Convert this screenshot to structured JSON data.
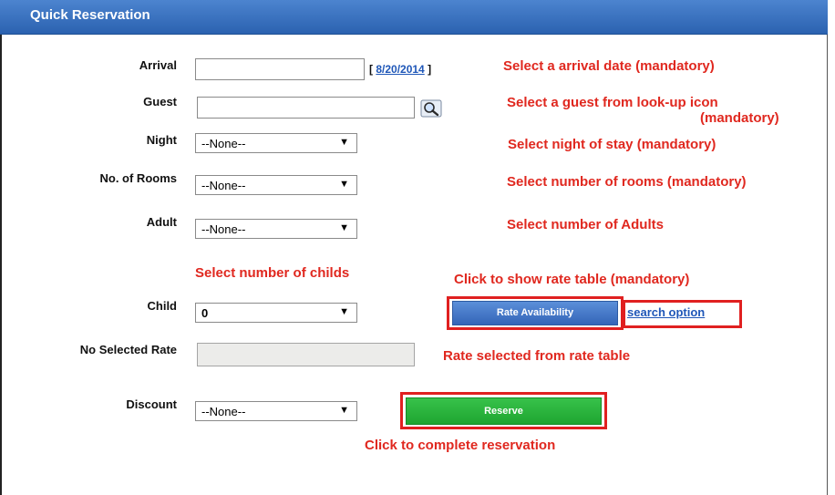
{
  "header": {
    "title": "Quick Reservation"
  },
  "form": {
    "arrival_label": "Arrival",
    "arrival_date_prefix": "[",
    "arrival_date_link": "8/20/2014",
    "arrival_date_suffix": "]",
    "guest_label": "Guest",
    "guest_lookup_icon": "magnifier-icon",
    "night_label": "Night",
    "night_value": "--None--",
    "rooms_label": "No. of Rooms",
    "rooms_value": "--None--",
    "adult_label": "Adult",
    "adult_value": "--None--",
    "child_label": "Child",
    "child_value": "0",
    "selected_rate_label": "No Selected Rate",
    "discount_label": "Discount",
    "discount_value": "--None--",
    "rate_button": "Rate Availability",
    "search_option_link": "search option",
    "reserve_button": "Reserve"
  },
  "annotations": {
    "arrival": "Select a arrival date (mandatory)",
    "guest_line1": "Select a guest from look-up icon",
    "guest_line2": "(mandatory)",
    "night": "Select night of stay (mandatory)",
    "rooms": "Select number of rooms (mandatory)",
    "adult": "Select number  of Adults",
    "child": "Select number of childs",
    "rate_table": "Click to show rate table (mandatory)",
    "rate_selected": "Rate selected from rate table",
    "complete": "Click to complete reservation"
  },
  "colors": {
    "header": "#2b62b0",
    "annotation_red": "#e0281f",
    "rate_button": "#3d74c9",
    "reserve_button": "#22b33a"
  }
}
